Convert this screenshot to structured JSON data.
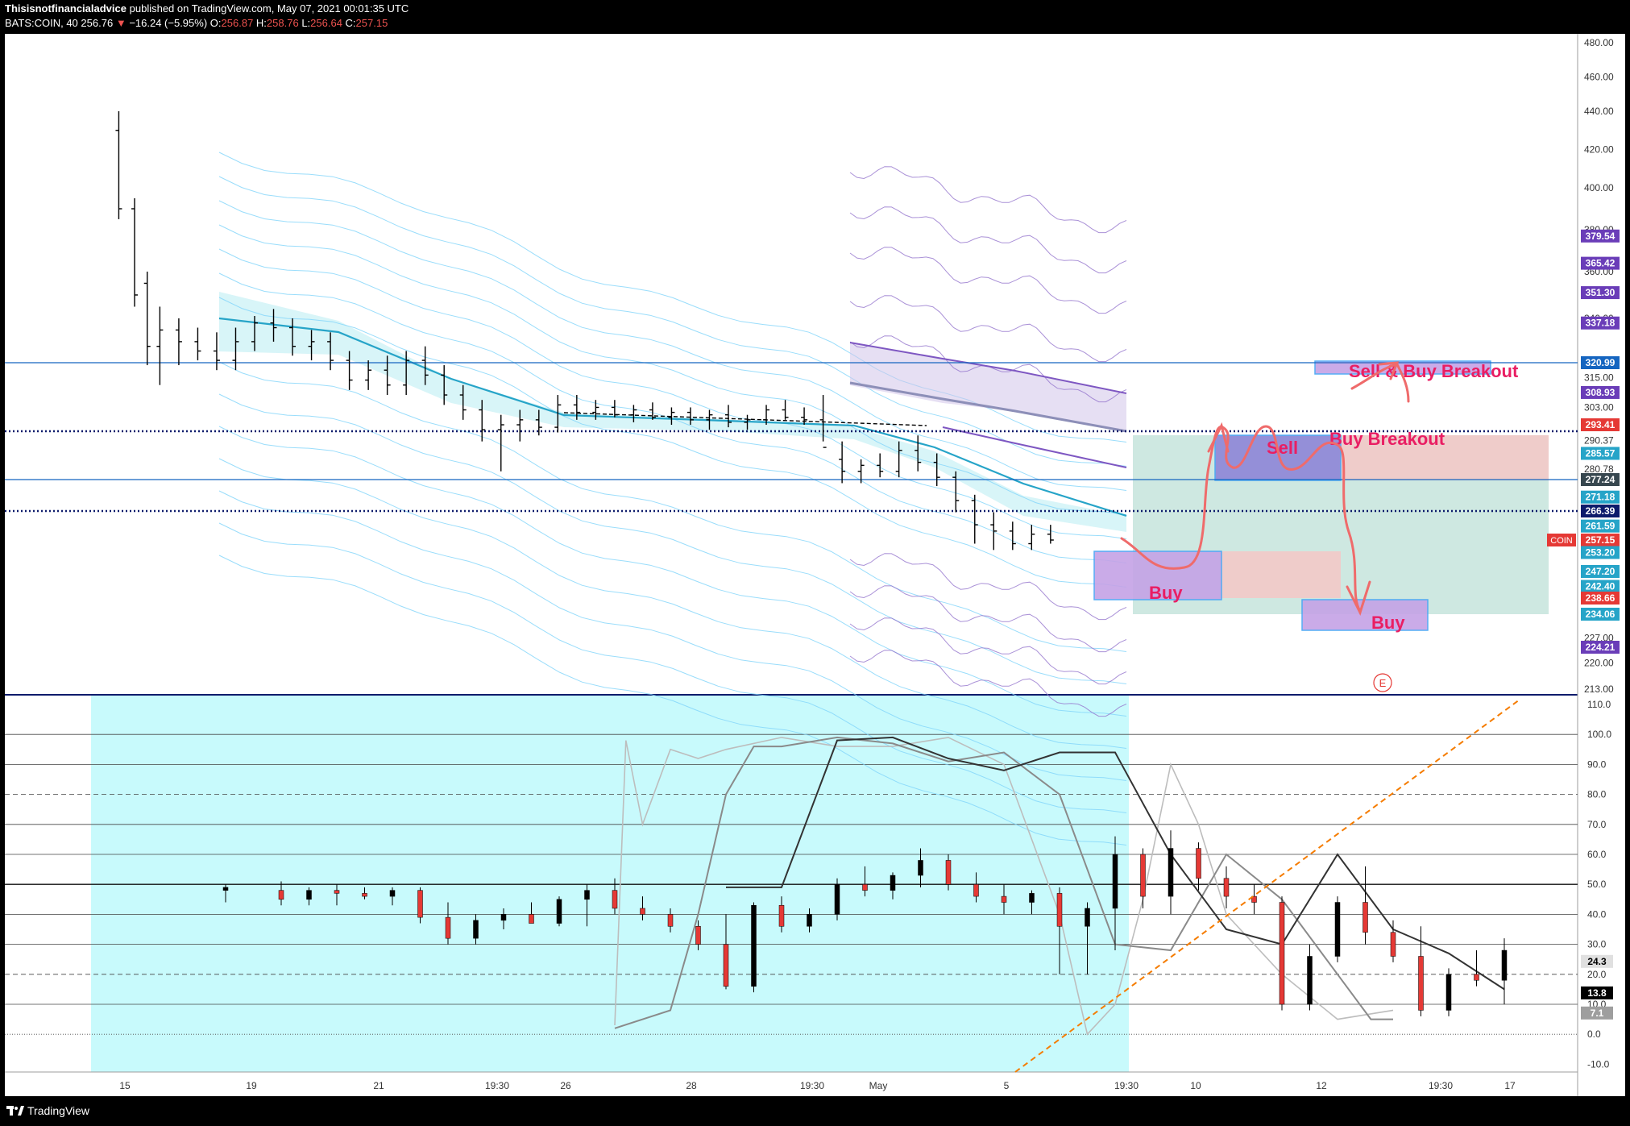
{
  "header": {
    "author": "Thisisnotfinancialadvice",
    "published": "published on TradingView.com, May 07, 2021 00:01:35 UTC",
    "symbol": "BATS:COIN, 40",
    "last": "256.76",
    "arrow": "▼",
    "change": "−16.24 (−5.95%)",
    "o_label": "O:",
    "o": "256.87",
    "h_label": "H:",
    "h": "258.76",
    "l_label": "L:",
    "l": "256.64",
    "c_label": "C:",
    "c": "257.15"
  },
  "footer": {
    "brand": "TradingView"
  },
  "colors": {
    "up": "#000000",
    "down": "#e53935",
    "level_line": "#1565c0",
    "dotted_line": "#0d1b6b",
    "annotation": "#e91e63",
    "arrow": "#ef6b6b",
    "osc_background": "#c8fafc",
    "dashed_trend": "#f57c00"
  },
  "chart_data": {
    "type": "candlestick",
    "price_pane": {
      "y_ticks": [
        "480.00",
        "460.00",
        "440.00",
        "420.00",
        "400.00",
        "380.00",
        "360.00",
        "340.00",
        "315.00",
        "303.00",
        "290.37",
        "280.78",
        "271.18",
        "261.59",
        "253.20",
        "247.20",
        "242.40",
        "227.00",
        "220.00",
        "213.00"
      ],
      "price_labels": [
        {
          "text": "379.54",
          "color": "#6a3db8",
          "p": 377
        },
        {
          "text": "365.42",
          "color": "#6a3db8",
          "p": 364
        },
        {
          "text": "351.30",
          "color": "#6a3db8",
          "p": 351
        },
        {
          "text": "337.18",
          "color": "#6a3db8",
          "p": 338
        },
        {
          "text": "320.99",
          "color": "#1565c0",
          "p": 320.99
        },
        {
          "text": "308.93",
          "color": "#6a3db8",
          "p": 309
        },
        {
          "text": "293.41",
          "color": "#e53935",
          "p": 296
        },
        {
          "text": "285.57",
          "color": "#26a4c8",
          "p": 286
        },
        {
          "text": "277.24",
          "color": "#37474f",
          "p": 277.24
        },
        {
          "text": "271.18",
          "color": "#26a4c8",
          "p": 271.2
        },
        {
          "text": "266.39",
          "color": "#0d1b6b",
          "p": 266.39
        },
        {
          "text": "261.59",
          "color": "#26a4c8",
          "p": 261.6
        },
        {
          "text": "257.15",
          "color": "#e53935",
          "p": 257.15
        },
        {
          "text": "253.20",
          "color": "#26a4c8",
          "p": 253.2
        },
        {
          "text": "247.20",
          "color": "#26a4c8",
          "p": 247.2
        },
        {
          "text": "242.40",
          "color": "#26a4c8",
          "p": 242.4
        },
        {
          "text": "238.66",
          "color": "#e53935",
          "p": 238.66
        },
        {
          "text": "234.06",
          "color": "#26a4c8",
          "p": 234.06
        },
        {
          "text": "224.21",
          "color": "#6a3db8",
          "p": 224.21
        }
      ],
      "symbol_tag": "COIN",
      "horizontal_levels": [
        320.99,
        277.24
      ],
      "dotted_levels": [
        293.41,
        266.39
      ],
      "annotations": [
        "Sell & Buy Breakout",
        "Buy Breakout",
        "Sell",
        "Buy",
        "Buy"
      ],
      "event_marker": "E",
      "candles": [
        {
          "d": 0.7,
          "o": 430,
          "h": 440,
          "l": 385,
          "c": 390
        },
        {
          "d": 1.2,
          "o": 390,
          "h": 395,
          "l": 345,
          "c": 350
        },
        {
          "d": 1.6,
          "o": 355,
          "h": 360,
          "l": 320,
          "c": 328
        },
        {
          "d": 2.0,
          "o": 328,
          "h": 345,
          "l": 312,
          "c": 335
        },
        {
          "d": 2.6,
          "o": 335,
          "h": 340,
          "l": 320,
          "c": 330
        },
        {
          "d": 3.2,
          "o": 330,
          "h": 336,
          "l": 322,
          "c": 326
        },
        {
          "d": 3.8,
          "o": 326,
          "h": 334,
          "l": 318,
          "c": 322
        },
        {
          "d": 4.4,
          "o": 322,
          "h": 336,
          "l": 318,
          "c": 330
        },
        {
          "d": 5.0,
          "o": 330,
          "h": 341,
          "l": 326,
          "c": 338
        },
        {
          "d": 5.6,
          "o": 338,
          "h": 344,
          "l": 330,
          "c": 336
        },
        {
          "d": 6.2,
          "o": 336,
          "h": 340,
          "l": 324,
          "c": 328
        },
        {
          "d": 6.8,
          "o": 328,
          "h": 335,
          "l": 322,
          "c": 330
        },
        {
          "d": 7.4,
          "o": 330,
          "h": 334,
          "l": 318,
          "c": 322
        },
        {
          "d": 8.0,
          "o": 322,
          "h": 326,
          "l": 310,
          "c": 314
        },
        {
          "d": 8.6,
          "o": 314,
          "h": 322,
          "l": 310,
          "c": 318
        },
        {
          "d": 9.2,
          "o": 318,
          "h": 324,
          "l": 308,
          "c": 312
        },
        {
          "d": 9.8,
          "o": 312,
          "h": 326,
          "l": 308,
          "c": 322
        },
        {
          "d": 10.4,
          "o": 322,
          "h": 328,
          "l": 312,
          "c": 316
        },
        {
          "d": 11.0,
          "o": 316,
          "h": 320,
          "l": 304,
          "c": 308
        },
        {
          "d": 11.6,
          "o": 308,
          "h": 312,
          "l": 298,
          "c": 302
        },
        {
          "d": 12.2,
          "o": 302,
          "h": 306,
          "l": 290,
          "c": 294
        },
        {
          "d": 12.8,
          "o": 294,
          "h": 300,
          "l": 280,
          "c": 296
        },
        {
          "d": 13.4,
          "o": 296,
          "h": 302,
          "l": 290,
          "c": 298
        },
        {
          "d": 14.0,
          "o": 298,
          "h": 302,
          "l": 292,
          "c": 295
        },
        {
          "d": 14.6,
          "o": 295,
          "h": 308,
          "l": 293,
          "c": 304
        },
        {
          "d": 15.2,
          "o": 304,
          "h": 308,
          "l": 298,
          "c": 301
        },
        {
          "d": 15.8,
          "o": 301,
          "h": 306,
          "l": 298,
          "c": 303
        },
        {
          "d": 16.4,
          "o": 303,
          "h": 306,
          "l": 299,
          "c": 300
        },
        {
          "d": 17.0,
          "o": 300,
          "h": 304,
          "l": 297,
          "c": 302
        },
        {
          "d": 17.6,
          "o": 302,
          "h": 305,
          "l": 298,
          "c": 299
        },
        {
          "d": 18.2,
          "o": 299,
          "h": 303,
          "l": 296,
          "c": 301
        },
        {
          "d": 18.8,
          "o": 301,
          "h": 303,
          "l": 296,
          "c": 298
        },
        {
          "d": 19.4,
          "o": 298,
          "h": 302,
          "l": 294,
          "c": 300
        },
        {
          "d": 20.0,
          "o": 300,
          "h": 304,
          "l": 295,
          "c": 297
        },
        {
          "d": 20.6,
          "o": 297,
          "h": 300,
          "l": 294,
          "c": 298
        },
        {
          "d": 21.2,
          "o": 298,
          "h": 304,
          "l": 296,
          "c": 302
        },
        {
          "d": 21.8,
          "o": 302,
          "h": 306,
          "l": 298,
          "c": 299
        },
        {
          "d": 22.4,
          "o": 299,
          "h": 303,
          "l": 296,
          "c": 298
        },
        {
          "d": 23.0,
          "o": 298,
          "h": 308,
          "l": 290,
          "c": 288
        },
        {
          "d": 23.6,
          "o": 284,
          "h": 290,
          "l": 276,
          "c": 280
        },
        {
          "d": 24.2,
          "o": 280,
          "h": 284,
          "l": 276,
          "c": 282
        },
        {
          "d": 24.8,
          "o": 282,
          "h": 286,
          "l": 278,
          "c": 280
        },
        {
          "d": 25.4,
          "o": 280,
          "h": 290,
          "l": 278,
          "c": 287
        },
        {
          "d": 26.0,
          "o": 287,
          "h": 292,
          "l": 280,
          "c": 283
        },
        {
          "d": 26.6,
          "o": 283,
          "h": 286,
          "l": 275,
          "c": 278
        },
        {
          "d": 27.2,
          "o": 278,
          "h": 280,
          "l": 266,
          "c": 270
        },
        {
          "d": 27.8,
          "o": 270,
          "h": 272,
          "l": 256,
          "c": 262
        },
        {
          "d": 28.4,
          "o": 262,
          "h": 266,
          "l": 254,
          "c": 260
        },
        {
          "d": 29.0,
          "o": 260,
          "h": 263,
          "l": 254,
          "c": 256
        },
        {
          "d": 29.6,
          "o": 256,
          "h": 262,
          "l": 254,
          "c": 259
        },
        {
          "d": 30.2,
          "o": 259,
          "h": 262,
          "l": 256,
          "c": 257.15
        }
      ]
    },
    "x_axis": {
      "tick_labels": [
        "15",
        "19",
        "21",
        "19:30",
        "26",
        "28",
        "19:30",
        "May",
        "5",
        "19:30",
        "10",
        "12",
        "19:30",
        "17"
      ]
    },
    "osc_pane": {
      "y_ticks": [
        "110.0",
        "100.0",
        "90.0",
        "80.0",
        "70.0",
        "60.0",
        "50.0",
        "40.0",
        "30.0",
        "20.0",
        "10.0",
        "0.0",
        "-10.0"
      ],
      "labels": [
        {
          "text": "24.3",
          "v": 24.3,
          "bg": "#e0e0e0",
          "fg": "#000000"
        },
        {
          "text": "13.8",
          "v": 13.8,
          "bg": "#000000",
          "fg": "#ffffff"
        },
        {
          "text": "7.1",
          "v": 7.1,
          "bg": "#9e9e9e",
          "fg": "#ffffff"
        }
      ],
      "black_line": [
        [
          9,
          49
        ],
        [
          10,
          49
        ],
        [
          11,
          98
        ],
        [
          12,
          99
        ],
        [
          13,
          92
        ],
        [
          14,
          88
        ],
        [
          15,
          94
        ],
        [
          16,
          94
        ],
        [
          17,
          60
        ],
        [
          18,
          35
        ],
        [
          19,
          30
        ],
        [
          20,
          60
        ],
        [
          21,
          35
        ],
        [
          22,
          27
        ],
        [
          23,
          15
        ]
      ],
      "grey_line": [
        [
          7,
          2
        ],
        [
          8,
          8
        ],
        [
          8.5,
          40
        ],
        [
          9,
          80
        ],
        [
          9.5,
          96
        ],
        [
          10,
          96
        ],
        [
          11,
          99
        ],
        [
          12,
          97
        ],
        [
          13,
          91
        ],
        [
          14,
          94
        ],
        [
          15,
          80
        ],
        [
          16,
          30
        ],
        [
          17,
          28
        ],
        [
          18,
          60
        ],
        [
          19,
          45
        ],
        [
          20,
          20
        ],
        [
          20.6,
          5
        ],
        [
          21,
          5
        ]
      ],
      "light_line": [
        [
          7,
          3
        ],
        [
          7.2,
          98
        ],
        [
          7.5,
          70
        ],
        [
          8,
          95
        ],
        [
          8.5,
          92
        ],
        [
          9,
          95
        ],
        [
          10,
          99
        ],
        [
          11,
          96
        ],
        [
          12,
          96
        ],
        [
          13,
          99
        ],
        [
          14,
          90
        ],
        [
          15,
          40
        ],
        [
          15.5,
          0
        ],
        [
          16,
          10
        ],
        [
          16.5,
          45
        ],
        [
          17,
          90
        ],
        [
          17.5,
          70
        ],
        [
          18,
          40
        ],
        [
          19,
          20
        ],
        [
          20,
          5
        ],
        [
          21,
          8
        ]
      ],
      "candles": [
        {
          "d": 0.0,
          "o": 48,
          "h": 50,
          "l": 44,
          "c": 49
        },
        {
          "d": 1.0,
          "o": 48,
          "h": 51,
          "l": 43,
          "c": 45
        },
        {
          "d": 1.5,
          "o": 45,
          "h": 49,
          "l": 43,
          "c": 48
        },
        {
          "d": 2.0,
          "o": 48,
          "h": 50,
          "l": 43,
          "c": 47
        },
        {
          "d": 2.5,
          "o": 47,
          "h": 49,
          "l": 45,
          "c": 46
        },
        {
          "d": 3.0,
          "o": 46,
          "h": 49,
          "l": 43,
          "c": 48
        },
        {
          "d": 3.5,
          "o": 48,
          "h": 49,
          "l": 37,
          "c": 39
        },
        {
          "d": 4.0,
          "o": 39,
          "h": 44,
          "l": 30,
          "c": 32
        },
        {
          "d": 4.5,
          "o": 32,
          "h": 40,
          "l": 30,
          "c": 38
        },
        {
          "d": 5.0,
          "o": 38,
          "h": 42,
          "l": 35,
          "c": 40
        },
        {
          "d": 5.5,
          "o": 40,
          "h": 44,
          "l": 38,
          "c": 37
        },
        {
          "d": 6.0,
          "o": 37,
          "h": 46,
          "l": 36,
          "c": 45
        },
        {
          "d": 6.5,
          "o": 45,
          "h": 50,
          "l": 36,
          "c": 48
        },
        {
          "d": 7.0,
          "o": 48,
          "h": 52,
          "l": 40,
          "c": 42
        },
        {
          "d": 7.5,
          "o": 42,
          "h": 46,
          "l": 38,
          "c": 40
        },
        {
          "d": 8.0,
          "o": 40,
          "h": 42,
          "l": 34,
          "c": 36
        },
        {
          "d": 8.5,
          "o": 36,
          "h": 38,
          "l": 28,
          "c": 30
        },
        {
          "d": 9.0,
          "o": 30,
          "h": 40,
          "l": 15,
          "c": 16
        },
        {
          "d": 9.5,
          "o": 16,
          "h": 44,
          "l": 14,
          "c": 43
        },
        {
          "d": 10.0,
          "o": 43,
          "h": 46,
          "l": 34,
          "c": 36
        },
        {
          "d": 10.5,
          "o": 36,
          "h": 42,
          "l": 34,
          "c": 40
        },
        {
          "d": 11.0,
          "o": 40,
          "h": 52,
          "l": 38,
          "c": 50
        },
        {
          "d": 11.5,
          "o": 50,
          "h": 56,
          "l": 46,
          "c": 48
        },
        {
          "d": 12.0,
          "o": 48,
          "h": 54,
          "l": 45,
          "c": 53
        },
        {
          "d": 12.5,
          "o": 53,
          "h": 62,
          "l": 49,
          "c": 58
        },
        {
          "d": 13.0,
          "o": 58,
          "h": 60,
          "l": 48,
          "c": 50
        },
        {
          "d": 13.5,
          "o": 50,
          "h": 54,
          "l": 44,
          "c": 46
        },
        {
          "d": 14.0,
          "o": 46,
          "h": 50,
          "l": 40,
          "c": 44
        },
        {
          "d": 14.5,
          "o": 44,
          "h": 48,
          "l": 40,
          "c": 47
        },
        {
          "d": 15.0,
          "o": 47,
          "h": 49,
          "l": 20,
          "c": 36
        },
        {
          "d": 15.5,
          "o": 36,
          "h": 44,
          "l": 20,
          "c": 42
        },
        {
          "d": 16.0,
          "o": 42,
          "h": 66,
          "l": 28,
          "c": 60
        },
        {
          "d": 16.5,
          "o": 60,
          "h": 62,
          "l": 42,
          "c": 46
        },
        {
          "d": 17.0,
          "o": 46,
          "h": 68,
          "l": 40,
          "c": 62
        },
        {
          "d": 17.5,
          "o": 62,
          "h": 64,
          "l": 48,
          "c": 52
        },
        {
          "d": 18.0,
          "o": 52,
          "h": 56,
          "l": 42,
          "c": 46
        },
        {
          "d": 18.5,
          "o": 46,
          "h": 50,
          "l": 40,
          "c": 44
        },
        {
          "d": 19.0,
          "o": 44,
          "h": 46,
          "l": 8,
          "c": 10
        },
        {
          "d": 19.5,
          "o": 10,
          "h": 30,
          "l": 8,
          "c": 26
        },
        {
          "d": 20.0,
          "o": 26,
          "h": 46,
          "l": 24,
          "c": 44
        },
        {
          "d": 20.5,
          "o": 44,
          "h": 56,
          "l": 30,
          "c": 34
        },
        {
          "d": 21.0,
          "o": 34,
          "h": 38,
          "l": 24,
          "c": 26
        },
        {
          "d": 21.5,
          "o": 26,
          "h": 36,
          "l": 6,
          "c": 8
        },
        {
          "d": 22.0,
          "o": 8,
          "h": 22,
          "l": 6,
          "c": 20
        },
        {
          "d": 22.5,
          "o": 20,
          "h": 28,
          "l": 16,
          "c": 18
        },
        {
          "d": 23.0,
          "o": 18,
          "h": 32,
          "l": 10,
          "c": 28
        }
      ]
    }
  }
}
